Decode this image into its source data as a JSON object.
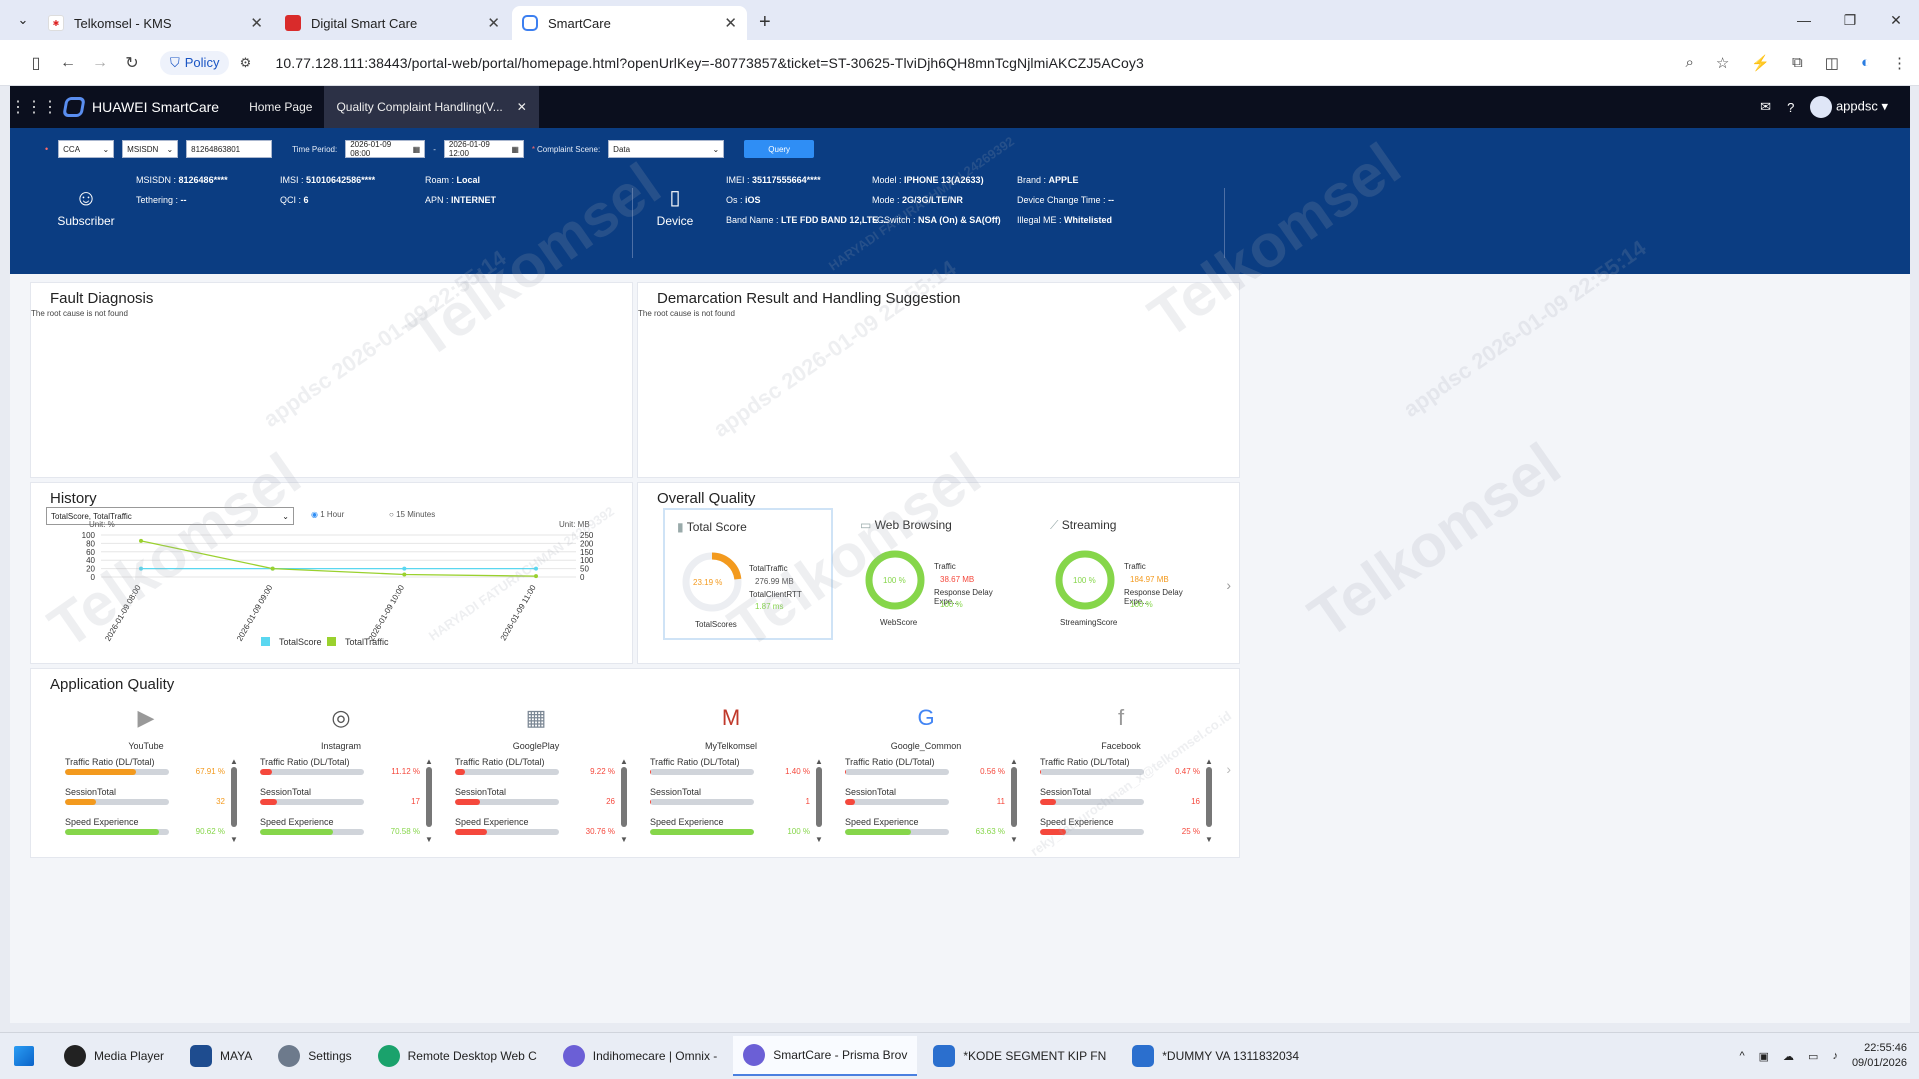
{
  "browser": {
    "tabs": [
      {
        "label": "Telkomsel - KMS"
      },
      {
        "label": "Digital Smart Care"
      },
      {
        "label": "SmartCare"
      }
    ],
    "policy": "Policy",
    "url": "10.77.128.111:38443/portal-web/portal/homepage.html?openUrlKey=-80773857&ticket=ST-30625-TlviDjh6QH8mnTcgNjlmiAKCZJ5ACoy3"
  },
  "app": {
    "brand": "HUAWEI SmartCare",
    "nav_home": "Home Page",
    "nav_active": "Quality Complaint Handling(V...",
    "user": "appdsc"
  },
  "query": {
    "type": "CCA",
    "idtype": "MSISDN",
    "msisdn": "81264863801",
    "period_label": "Time Period:",
    "start": "2026-01-09 08:00",
    "end": "2026-01-09 12:00",
    "scene_label": "Complaint Scene:",
    "scene": "Data",
    "query_btn": "Query"
  },
  "subscriber": {
    "title": "Subscriber",
    "msisdn_l": "MSISDN",
    "msisdn": "8126486****",
    "tether_l": "Tethering",
    "tether": "--",
    "imsi_l": "IMSI",
    "imsi": "51010642586****",
    "qci_l": "QCI",
    "qci": "6",
    "roam_l": "Roam",
    "roam": "Local",
    "apn_l": "APN",
    "apn": "INTERNET"
  },
  "device": {
    "title": "Device",
    "imei_l": "IMEI",
    "imei": "35117555664****",
    "os_l": "Os",
    "os": "iOS",
    "band_l": "Band Name",
    "band": "LTE FDD BAND 12,LTE ...",
    "model_l": "Model",
    "model": "IPHONE 13(A2633)",
    "mode_l": "Mode",
    "mode": "2G/3G/LTE/NR",
    "sg_l": "5GSwitch",
    "sg": "NSA (On) & SA(Off)",
    "brand_l": "Brand",
    "brand": "APPLE",
    "dct_l": "Device Change Time",
    "dct": "--",
    "illegal_l": "Illegal ME",
    "illegal": "Whitelisted"
  },
  "fault": {
    "title": "Fault Diagnosis",
    "note": "The root cause is not found"
  },
  "demarc": {
    "title": "Demarcation Result and Handling Suggestion",
    "note": "The root cause is not found"
  },
  "history": {
    "title": "History",
    "select": "TotalScore, TotalTraffic",
    "opt1": "1 Hour",
    "opt2": "15 Minutes",
    "unit_left": "Unit: %",
    "unit_right": "Unit: MB",
    "legend1": "TotalScore",
    "legend2": "TotalTraffic"
  },
  "chart_data": {
    "type": "line",
    "x": [
      "2026-01-09 08:00",
      "2026-01-09 09:00",
      "2026-01-09 10:00",
      "2026-01-09 11:00"
    ],
    "series": [
      {
        "name": "TotalScore",
        "axis": "left",
        "values": [
          20,
          20,
          20,
          20
        ],
        "color": "#5ad7f0"
      },
      {
        "name": "TotalTraffic",
        "axis": "right",
        "values": [
          215,
          50,
          15,
          5
        ],
        "color": "#9ad12e"
      }
    ],
    "ylim_left": [
      0,
      100
    ],
    "yticks_left": [
      0,
      20,
      40,
      60,
      80,
      100
    ],
    "ylim_right": [
      0,
      250
    ],
    "yticks_right": [
      0,
      50,
      100,
      150,
      200,
      250
    ],
    "ylabel_left": "Unit: %",
    "ylabel_right": "Unit: MB",
    "grid": true,
    "legend": "bottom"
  },
  "overall": {
    "title": "Overall Quality",
    "total": {
      "name": "Total Score",
      "pct": "23.19 %",
      "pct_val": 23.19,
      "traffic_l": "TotalTraffic",
      "traffic": "276.99 MB",
      "rtt_l": "TotalClientRTT",
      "rtt": "1.87 ms",
      "foot": "TotalScores"
    },
    "web": {
      "name": "Web Browsing",
      "pct": "100 %",
      "pct_val": 100,
      "traffic_l": "Traffic",
      "traffic": "38.67 MB",
      "delay_l": "Response Delay Expe...",
      "delay": "100 %",
      "foot": "WebScore"
    },
    "stream": {
      "name": "Streaming",
      "pct": "100 %",
      "pct_val": 100,
      "traffic_l": "Traffic",
      "traffic": "184.97 MB",
      "delay_l": "Response Delay Expe...",
      "delay": "100 %",
      "foot": "StreamingScore"
    }
  },
  "appq": {
    "title": "Application Quality",
    "m1": "Traffic Ratio (DL/Total)",
    "m2": "SessionTotal",
    "m3": "Speed Experience",
    "apps": [
      {
        "name": "YouTube",
        "ratio": "67.91 %",
        "ratio_v": 67.91,
        "session": "32",
        "session_v": 30,
        "speed": "90.62 %",
        "speed_v": 90.62
      },
      {
        "name": "Instagram",
        "ratio": "11.12 %",
        "ratio_v": 11.12,
        "session": "17",
        "session_v": 16,
        "speed": "70.58 %",
        "speed_v": 70.58
      },
      {
        "name": "GooglePlay",
        "ratio": "9.22 %",
        "ratio_v": 9.22,
        "session": "26",
        "session_v": 24,
        "speed": "30.76 %",
        "speed_v": 30.76
      },
      {
        "name": "MyTelkomsel",
        "ratio": "1.40 %",
        "ratio_v": 1.4,
        "session": "1",
        "session_v": 1,
        "speed": "100 %",
        "speed_v": 100
      },
      {
        "name": "Google_Common",
        "ratio": "0.56 %",
        "ratio_v": 0.56,
        "session": "11",
        "session_v": 10,
        "speed": "63.63 %",
        "speed_v": 63.63
      },
      {
        "name": "Facebook",
        "ratio": "0.47 %",
        "ratio_v": 0.47,
        "session": "16",
        "session_v": 15,
        "speed": "25 %",
        "speed_v": 25
      }
    ]
  },
  "taskbar": {
    "items": [
      "Media Player",
      "MAYA",
      "Settings",
      "Remote Desktop Web C",
      "Indihomecare | Omnix -",
      "SmartCare - Prisma Brov",
      "*KODE SEGMENT KIP FN",
      "*DUMMY VA 1311832034"
    ],
    "time": "22:55:46",
    "date": "09/01/2026"
  },
  "watermarks": [
    "Telkomsel",
    "appdsc 2026-01-09 22:55:14",
    "HARYADI FATURACHMAN 24269392",
    "reky_fathurochman_x@telkomsel.co.id"
  ],
  "colors": {
    "header": "#0b3d82",
    "accent": "#2f8ef5",
    "good": "#86d64a",
    "bad": "#f5483c",
    "warn": "#f39a1e"
  }
}
